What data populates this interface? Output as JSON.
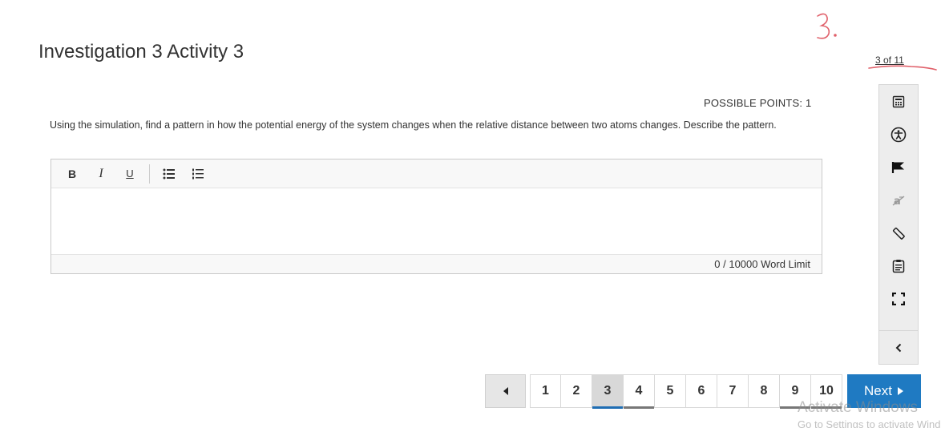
{
  "page": {
    "title": "Investigation 3 Activity 3",
    "progress": "3 of 11",
    "annotation": "3."
  },
  "question": {
    "points_label": "POSSIBLE POINTS: 1",
    "prompt": "Using the simulation, find a pattern in how the potential energy of the system changes when the relative distance between two atoms changes. Describe the pattern."
  },
  "editor": {
    "toolbar": {
      "bold": "B",
      "italic": "I",
      "underline": "U",
      "bullet_list_icon": "bulleted-list-icon",
      "numbered_list_icon": "numbered-list-icon"
    },
    "value": "",
    "word_count": "0",
    "word_limit": "/ 10000 Word Limit"
  },
  "side_tools": [
    {
      "icon": "calculator-icon"
    },
    {
      "icon": "accessibility-icon"
    },
    {
      "icon": "flag-icon"
    },
    {
      "icon": "text-strike-icon"
    },
    {
      "icon": "ruler-icon"
    },
    {
      "icon": "notepad-icon"
    },
    {
      "icon": "fullscreen-icon"
    }
  ],
  "side_collapse_icon": "chevron-left-icon",
  "pagination": {
    "pages": [
      "1",
      "2",
      "3",
      "4",
      "5",
      "6",
      "7",
      "8",
      "9",
      "10"
    ],
    "current": "3",
    "next_label": "Next"
  },
  "watermark": {
    "line1": "Activate Windows",
    "line2": "Go to Settings to activate Windows."
  },
  "colors": {
    "accent": "#1f7ac2",
    "annotation": "#e0606a"
  }
}
